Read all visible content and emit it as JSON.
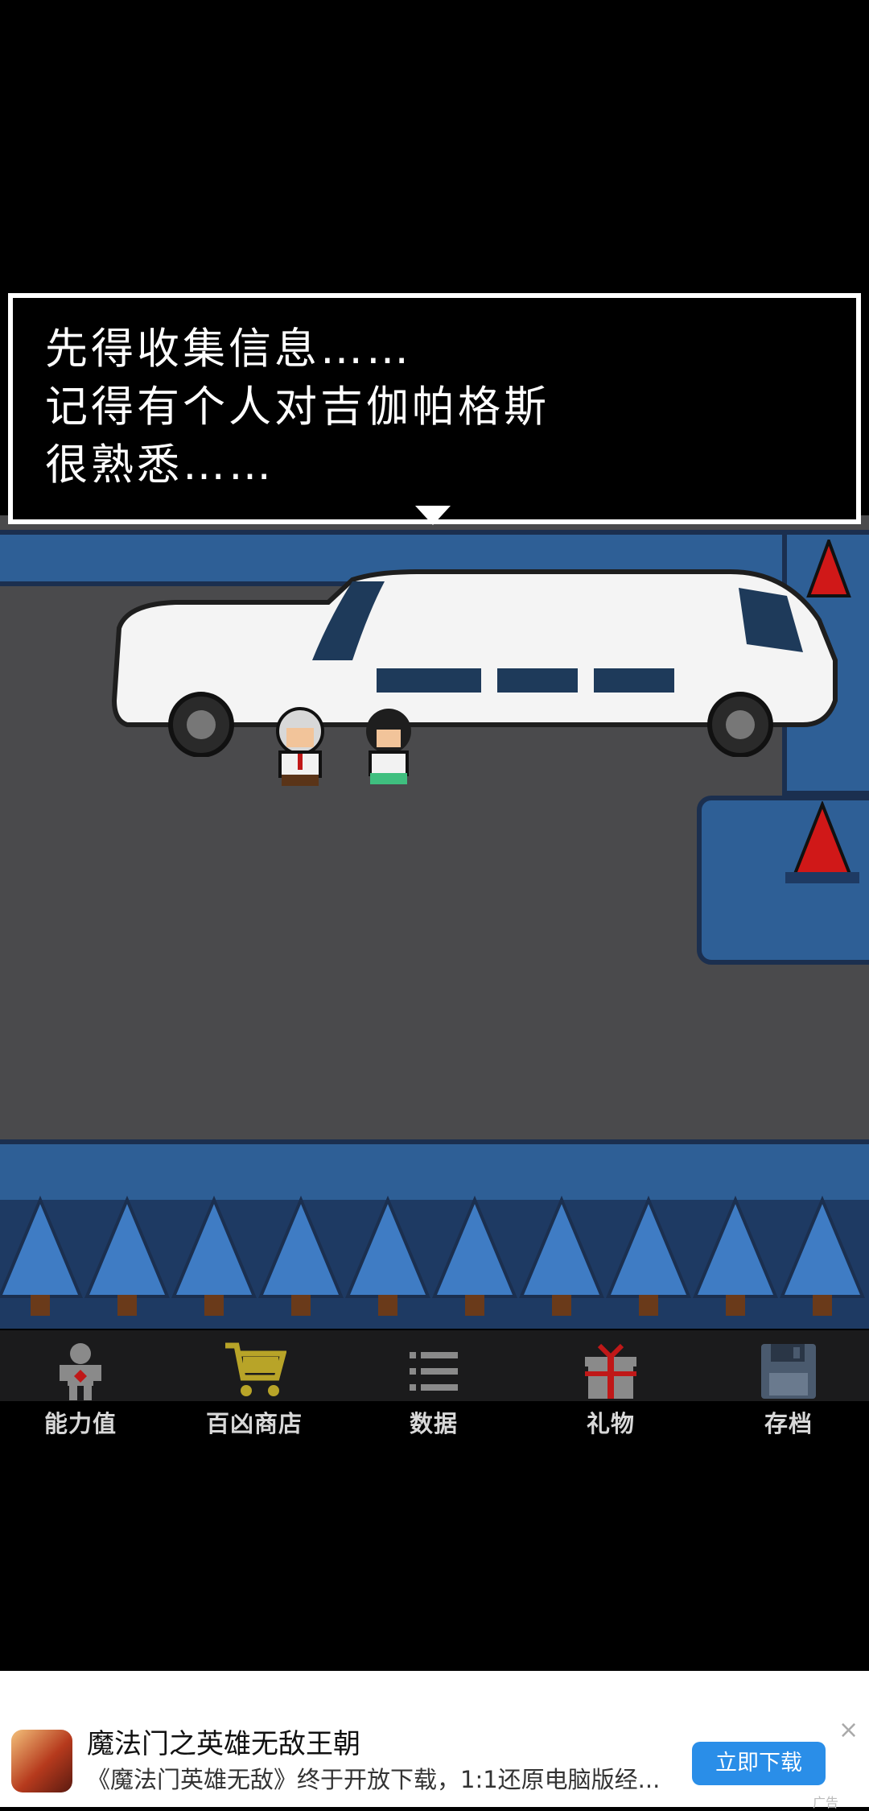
{
  "dialog": {
    "lines": [
      "先得收集信息……",
      "记得有个人对吉伽帕格斯",
      "很熟悉……"
    ]
  },
  "menu": {
    "items": [
      {
        "label": "能力值",
        "icon": "person-icon"
      },
      {
        "label": "百凶商店",
        "icon": "shopping-cart-icon"
      },
      {
        "label": "数据",
        "icon": "list-icon"
      },
      {
        "label": "礼物",
        "icon": "gift-icon"
      },
      {
        "label": "存档",
        "icon": "floppy-disk-icon"
      }
    ]
  },
  "ad": {
    "title": "魔法门之英雄无敌王朝",
    "description": "《魔法门英雄无敌》终于开放下载，1:1还原电脑版经...",
    "button": "立即下载",
    "tag": "广告",
    "close": "×"
  },
  "colors": {
    "road": "#4a4a4c",
    "curb": "#2e5f96",
    "menu_bg": "#1b1b1c",
    "ad_button": "#2a8ee8"
  }
}
